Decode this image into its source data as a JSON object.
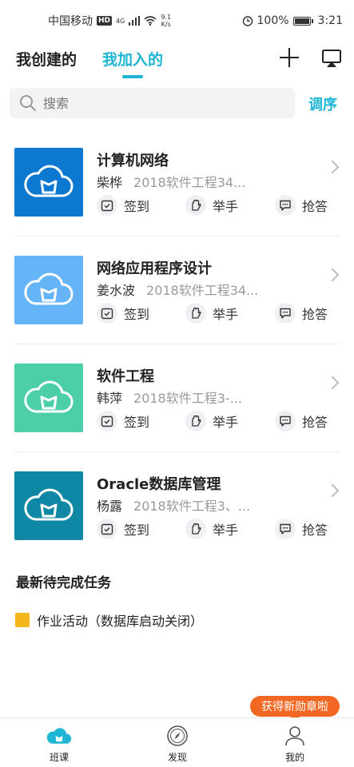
{
  "status_bar": {
    "carrier": "中国移动",
    "hd": "HD",
    "signal": "4G",
    "net_speed_value": "9.1",
    "net_speed_unit": "K/s",
    "battery": "100%",
    "time": "3:21"
  },
  "top_tabs": {
    "created": "我创建的",
    "joined": "我加入的",
    "active": "joined"
  },
  "search": {
    "placeholder": "搜索"
  },
  "sort_label": "调序",
  "courses": [
    {
      "name": "计算机网络",
      "teacher": "柴桦",
      "class": "2018软件工程34...",
      "cover_color": "#0d78d0"
    },
    {
      "name": "网络应用程序设计",
      "teacher": "姜水波",
      "class": "2018软件工程34...",
      "cover_color": "#64b4f7"
    },
    {
      "name": "软件工程",
      "teacher": "韩萍",
      "class": "2018软件工程3-...",
      "cover_color": "#4ccfa9"
    },
    {
      "name": "Oracle数据库管理",
      "teacher": "杨露",
      "class": "2018软件工程3、...",
      "cover_color": "#0e88a4"
    }
  ],
  "actions": {
    "signin": "签到",
    "raise_hand": "举手",
    "answer": "抢答"
  },
  "tasks": {
    "title": "最新待完成任务",
    "items": [
      {
        "label": "作业活动（数据库启动关闭）",
        "icon_color": "#f5b51d"
      }
    ]
  },
  "badge_bubble": "获得新勋章啦",
  "bottom_nav": {
    "items": [
      {
        "label": "班课",
        "icon": "cloud-icon",
        "active": true
      },
      {
        "label": "发现",
        "icon": "compass-icon",
        "active": false
      },
      {
        "label": "我的",
        "icon": "user-icon",
        "active": false
      }
    ]
  },
  "colors": {
    "accent": "#1fb5d4",
    "badge": "#f26722"
  }
}
